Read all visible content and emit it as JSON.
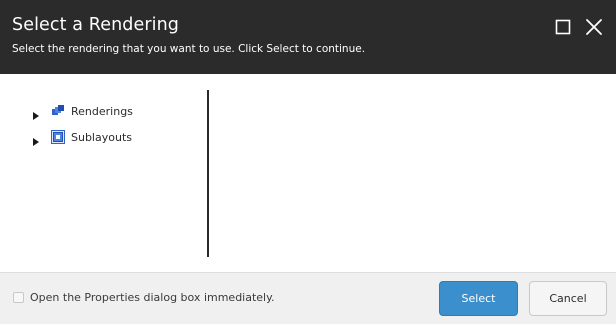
{
  "dialog": {
    "title": "Select a Rendering",
    "subtitle": "Select the rendering that you want to use. Click Select to continue."
  },
  "window_controls": {
    "maximize_icon": "maximize-icon",
    "close_icon": "close-icon"
  },
  "tree": {
    "nodes": [
      {
        "label": "Renderings",
        "icon": "renderings-icon",
        "expanded": false
      },
      {
        "label": "Sublayouts",
        "icon": "sublayouts-icon",
        "expanded": false
      }
    ]
  },
  "footer": {
    "checkbox_label": "Open the Properties dialog box immediately.",
    "checkbox_checked": false,
    "select_label": "Select",
    "cancel_label": "Cancel"
  },
  "colors": {
    "header_bg": "#2b2b2b",
    "primary_button": "#3a8fcc",
    "footer_bg": "#f0f0f0"
  }
}
